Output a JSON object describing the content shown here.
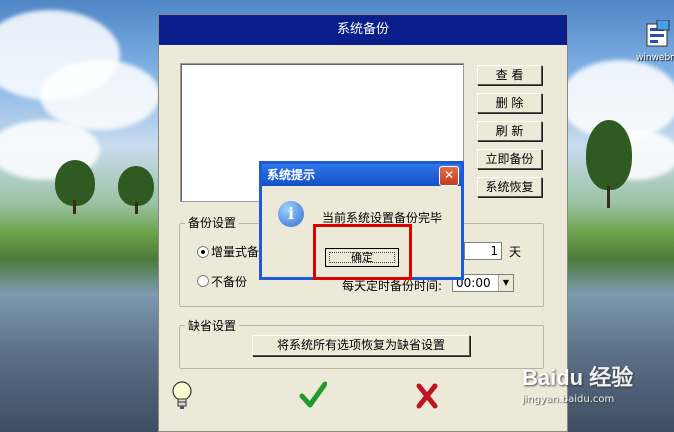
{
  "desktop": {
    "icon_label": "winwebmai"
  },
  "main_window": {
    "title": "系统备份",
    "buttons": {
      "view": "查 看",
      "delete": "删 除",
      "refresh": "刷 新",
      "backup_now": "立即备份",
      "restore": "系统恢复"
    },
    "backup_settings": {
      "group_title": "备份设置",
      "incremental_label": "增量式备",
      "no_backup_label": "不备份",
      "days_value": "1",
      "days_unit": "天",
      "daily_time_label": "每天定时备份时间:",
      "time_value": "00:00"
    },
    "default_settings": {
      "group_title": "缺省设置",
      "restore_default_button": "将系统所有选项恢复为缺省设置"
    }
  },
  "dialog": {
    "title": "系统提示",
    "close": "✕",
    "message": "当前系统设置备份完毕",
    "ok_button": "确定"
  },
  "watermark": {
    "logo": "Baidu 经验",
    "sub": "jingyan.baidu.com"
  },
  "colors": {
    "title_bar": "#0a1f8c",
    "dialog_title": "#1450c4",
    "highlight": "#e00000",
    "check_green": "#1f9a2a",
    "cross_red": "#c0131f"
  }
}
